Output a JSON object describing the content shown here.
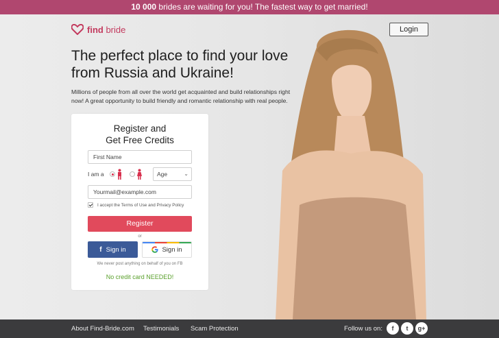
{
  "promo": {
    "count": "10 000",
    "text": "brides are waiting for you! The fastest way to get married!"
  },
  "brand": {
    "name_a": "find",
    "name_b": "bride",
    "color": "#c33a5e"
  },
  "header": {
    "login_label": "Login"
  },
  "hero": {
    "headline_line1": "The perfect place to find your love",
    "headline_line2": "from Russia and Ukraine!",
    "subtext_line1": "Millions of people from all over the world get acquainted and build relationships right",
    "subtext_line2": "now! A great opportunity to build friendly and romantic relationship with real people."
  },
  "form": {
    "title_line1": "Register and",
    "title_line2": "Get Free Credits",
    "first_name_placeholder": "First Name",
    "iam_label": "I am a",
    "age_label": "Age",
    "email_placeholder": "Yourmail@example.com",
    "terms_text": "I accept the Terms of Use and Privacy Policy",
    "register_label": "Register",
    "or_text": "or",
    "facebook_label": "Sign in",
    "google_label": "Sign in",
    "never_post_text": "We never post anything on behalf of you on FB",
    "no_credit_text": "No credit card NEEDED!",
    "register_color": "#e14a5c",
    "facebook_color": "#3b5a98",
    "no_credit_color": "#5aa02c"
  },
  "footer": {
    "links": [
      "About Find-Bride.com",
      "Testimonials",
      "Scam Protection"
    ],
    "follow_label": "Follow us on:",
    "social_icons": [
      "facebook-icon",
      "twitter-icon",
      "google-plus-icon"
    ],
    "social_glyphs": [
      "f",
      "t",
      "g+"
    ]
  },
  "colors": {
    "topbar": "#b0476f",
    "footer": "#3b3b3d"
  }
}
